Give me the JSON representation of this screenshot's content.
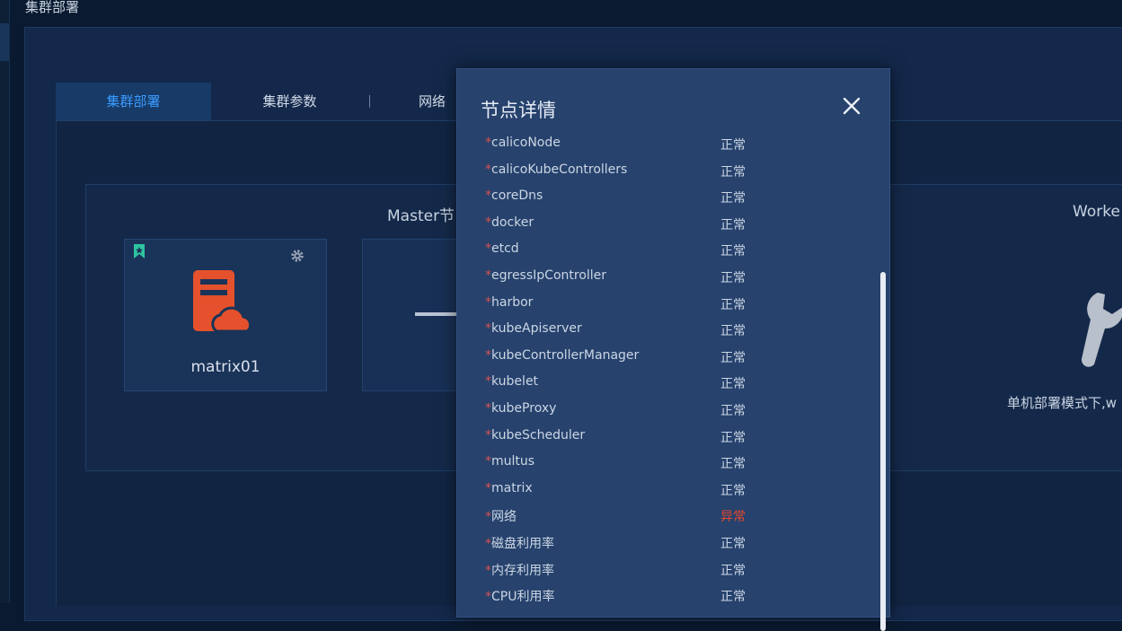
{
  "page": {
    "title": "集群部署"
  },
  "tabs": [
    {
      "label": "集群部署",
      "active": true
    },
    {
      "label": "集群参数",
      "active": false
    },
    {
      "label": "网络",
      "active": false
    }
  ],
  "master": {
    "title": "Master节",
    "node_name": "matrix01"
  },
  "worker": {
    "title": "Worke",
    "text": "单机部署模式下,w"
  },
  "modal": {
    "title": "节点详情",
    "rows": [
      {
        "label": "calicoNode",
        "status": "正常"
      },
      {
        "label": "calicoKubeControllers",
        "status": "正常"
      },
      {
        "label": "coreDns",
        "status": "正常"
      },
      {
        "label": "docker",
        "status": "正常"
      },
      {
        "label": "etcd",
        "status": "正常"
      },
      {
        "label": "egressIpController",
        "status": "正常"
      },
      {
        "label": "harbor",
        "status": "正常"
      },
      {
        "label": "kubeApiserver",
        "status": "正常"
      },
      {
        "label": "kubeControllerManager",
        "status": "正常"
      },
      {
        "label": "kubelet",
        "status": "正常"
      },
      {
        "label": "kubeProxy",
        "status": "正常"
      },
      {
        "label": "kubeScheduler",
        "status": "正常"
      },
      {
        "label": "multus",
        "status": "正常"
      },
      {
        "label": "matrix",
        "status": "正常"
      },
      {
        "label": "网络",
        "status": "异常"
      },
      {
        "label": "磁盘利用率",
        "status": "正常"
      },
      {
        "label": "内存利用率",
        "status": "正常"
      },
      {
        "label": "CPU利用率",
        "status": "正常"
      }
    ]
  },
  "colors": {
    "accent": "#3b9bff",
    "error": "#e6482d",
    "server_icon": "#e5512c",
    "bookmark": "#2fc4a0"
  },
  "icons": {
    "bookmark": "bookmark-icon",
    "gear": "gear-icon",
    "server": "server-cloud-icon",
    "close": "close-icon",
    "wrench": "wrench-icon"
  }
}
